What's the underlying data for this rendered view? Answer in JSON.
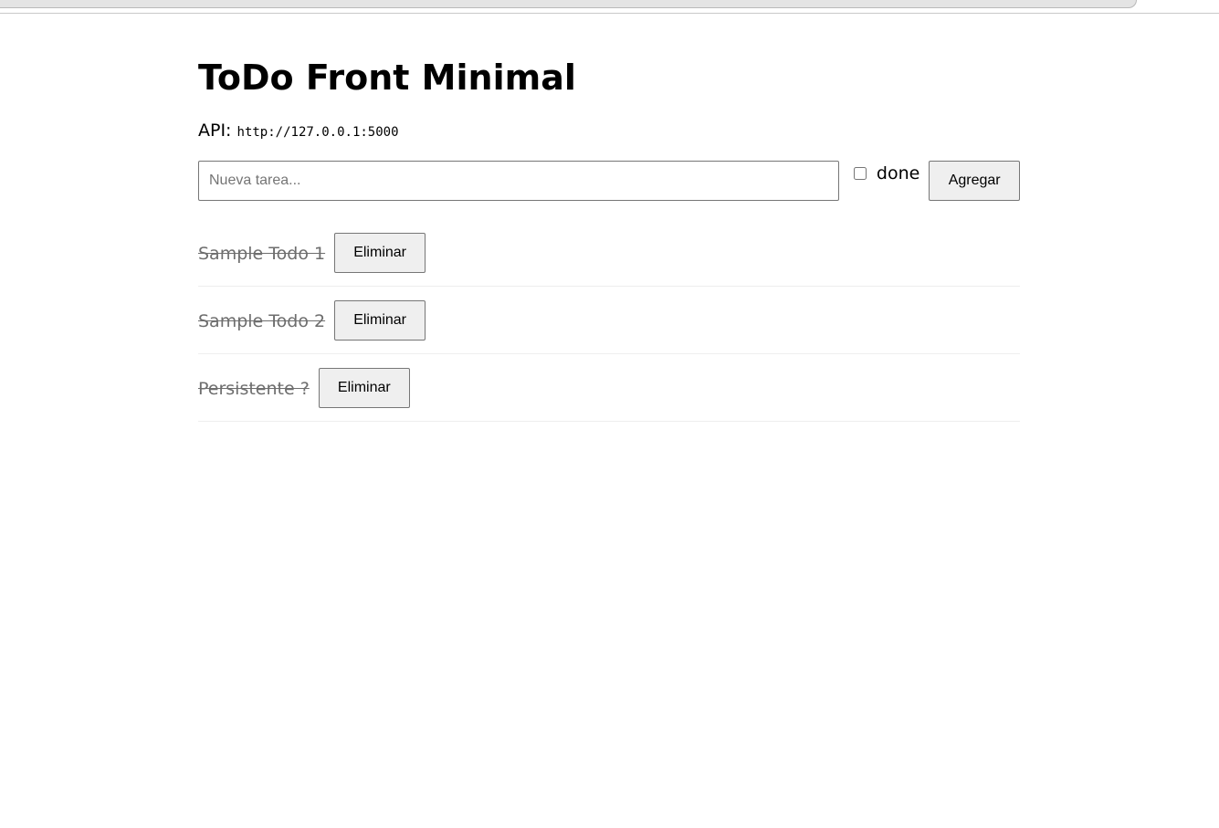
{
  "page": {
    "title": "ToDo Front Minimal",
    "api_label": "API:",
    "api_url": "http://127.0.0.1:5000"
  },
  "form": {
    "placeholder": "Nueva tarea...",
    "value": "",
    "done_label": "done",
    "done_checked": false,
    "add_label": "Agregar"
  },
  "todos": [
    {
      "text": "Sample Todo 1",
      "done": true,
      "delete_label": "Eliminar"
    },
    {
      "text": "Sample Todo 2",
      "done": true,
      "delete_label": "Eliminar"
    },
    {
      "text": "Persistente ?",
      "done": true,
      "delete_label": "Eliminar"
    }
  ]
}
